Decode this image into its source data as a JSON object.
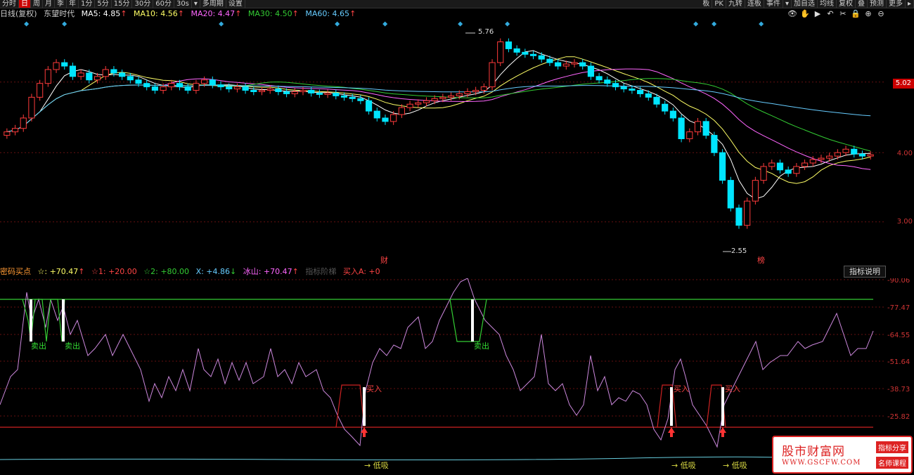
{
  "toolbar": {
    "left": [
      "分时",
      "日",
      "周",
      "月",
      "季",
      "年",
      "1分",
      "5分",
      "15分",
      "30分",
      "60分",
      "30s",
      "▾",
      "多周期",
      "设置"
    ],
    "active": "日",
    "right": [
      "板",
      "PK",
      "九转",
      "连板",
      "事件",
      "▾",
      "加自选",
      "均线",
      "复权",
      "叠",
      "预测",
      "更多",
      "▸"
    ]
  },
  "main_legend": {
    "title": "日线(复权)",
    "stock": "东望时代",
    "ma5": "MA5: 4.85",
    "ma10": "MA10: 4.56",
    "ma20": "MA20: 4.47",
    "ma30": "MA30: 4.50",
    "ma60": "MA60: 4.65",
    "arrow": "↑"
  },
  "top_icons": [
    "eye-icon",
    "hand-icon",
    "play-icon",
    "undo-icon",
    "scissors-icon",
    "lock-icon",
    "plus-icon",
    "minus-icon"
  ],
  "top_icon_glyphs": [
    "👁",
    "✋",
    "▶",
    "↶",
    "✂",
    "🔒",
    "⊕",
    "⊖"
  ],
  "price_axis": [
    "4.00",
    "3.00"
  ],
  "price_tag": "5.02",
  "annotations": {
    "high": "5.76",
    "low": "2.55",
    "cai": "财",
    "bang": "榜"
  },
  "indicator_legend": {
    "name": "密码买点",
    "star": "☆: +70.47",
    "s1": "☆1: +20.00",
    "s2": "☆2: +80.00",
    "x": "X: +4.86",
    "x_arrow": "↓",
    "ice": "冰山: +70.47",
    "ladder": "指标阶梯",
    "buyA": "买入A: +0",
    "arrow": "↑"
  },
  "indicator_button": "指标说明",
  "indicator_axis": [
    "90.06",
    "77.47",
    "64.55",
    "51.64",
    "38.73",
    "25.82"
  ],
  "signals": {
    "sell": "卖出",
    "buy": "买入",
    "low": "低吸"
  },
  "watermark": {
    "title": "股市财富网",
    "url": "WWW.GSCFW.COM",
    "tag1": "指标分享",
    "tag2": "名师课程"
  },
  "colors": {
    "bg": "#000000",
    "up": "#ff3b3b",
    "down": "#00e5ff",
    "ma5": "#ffffff",
    "ma10": "#ffff66",
    "ma20": "#ff66ff",
    "ma30": "#33cc33",
    "ma60": "#66ccff"
  },
  "chart_data": {
    "type": "candlestick",
    "title": "东望时代",
    "ylim": [
      2.5,
      5.9
    ],
    "ticks": [
      3.0,
      4.0,
      5.02
    ],
    "closes": [
      4.3,
      4.35,
      4.5,
      4.8,
      5.0,
      5.2,
      5.3,
      5.25,
      5.1,
      5.15,
      5.05,
      5.1,
      5.2,
      5.15,
      5.1,
      5.05,
      5.0,
      4.95,
      4.9,
      4.95,
      5.0,
      4.95,
      4.9,
      5.0,
      5.05,
      4.98,
      4.95,
      4.92,
      4.95,
      4.9,
      4.88,
      4.9,
      4.92,
      4.88,
      4.85,
      4.88,
      4.9,
      4.86,
      4.84,
      4.86,
      4.82,
      4.8,
      4.78,
      4.75,
      4.6,
      4.5,
      4.45,
      4.55,
      4.65,
      4.7,
      4.72,
      4.75,
      4.78,
      4.8,
      4.82,
      4.85,
      4.88,
      4.9,
      4.95,
      5.3,
      5.6,
      5.5,
      5.45,
      5.42,
      5.4,
      5.35,
      5.3,
      5.25,
      5.28,
      5.3,
      5.25,
      5.1,
      5.05,
      5.0,
      4.95,
      4.92,
      4.9,
      4.85,
      4.8,
      4.7,
      4.6,
      4.5,
      4.2,
      4.3,
      4.45,
      4.25,
      4.0,
      3.6,
      3.2,
      2.95,
      3.3,
      3.6,
      3.8,
      3.85,
      3.75,
      3.7,
      3.8,
      3.85,
      3.9,
      3.92,
      3.95,
      4.0,
      4.05,
      3.98,
      3.95,
      3.97
    ],
    "annotations": [
      "5.76",
      "2.55"
    ]
  }
}
